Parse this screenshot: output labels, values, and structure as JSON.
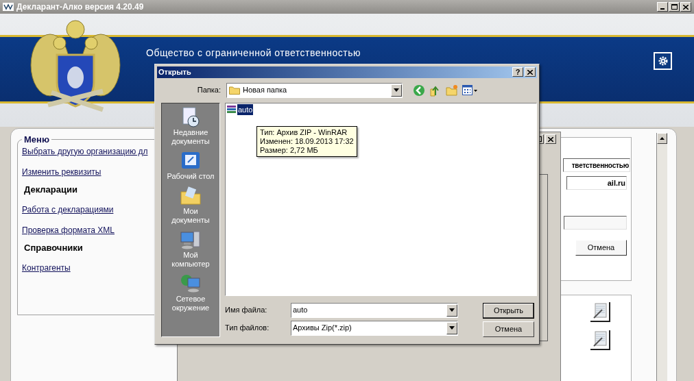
{
  "window": {
    "title": "Декларант-Алко версия 4.20.49"
  },
  "header": {
    "company": "Общество с ограниченной ответственностью"
  },
  "menu": {
    "legend": "Меню",
    "entries": [
      {
        "kind": "link",
        "text": "Выбрать другую организацию дл"
      },
      {
        "kind": "link",
        "text": "Изменить реквизиты"
      },
      {
        "kind": "heading",
        "text": "Декларации"
      },
      {
        "kind": "link",
        "text": "Работа с декларациями"
      },
      {
        "kind": "link",
        "text": "Проверка формата XML"
      },
      {
        "kind": "heading",
        "text": "Справочники"
      },
      {
        "kind": "link",
        "text": "Контрагенты"
      }
    ]
  },
  "org_form": {
    "fields": [
      {
        "value": "тветственностью"
      },
      {
        "value": "ail.ru"
      }
    ],
    "cancel_button": "Отмена"
  },
  "open_dialog": {
    "title": "Открыть",
    "help_button": "?",
    "folder_label": "Папка:",
    "folder": "Новая папка",
    "places": [
      {
        "kind": "recent",
        "label": "Недавние документы"
      },
      {
        "kind": "desktop",
        "label": "Рабочий стол"
      },
      {
        "kind": "documents",
        "label": "Мои документы"
      },
      {
        "kind": "computer",
        "label": "Мой компьютер"
      },
      {
        "kind": "network",
        "label": "Сетевое окружение"
      }
    ],
    "files": [
      {
        "name": "auto",
        "selected": true
      }
    ],
    "tooltip": [
      "Тип: Архив ZIP - WinRAR",
      "Изменен: 18.09.2013 17:32",
      "Размер: 2,72 МБ"
    ],
    "filename_label": "Имя файла:",
    "filename": "auto",
    "filetype_label": "Тип файлов:",
    "filetype": "Архивы Zip(*.zip)",
    "open_button": "Открыть",
    "cancel_button": "Отмена"
  }
}
